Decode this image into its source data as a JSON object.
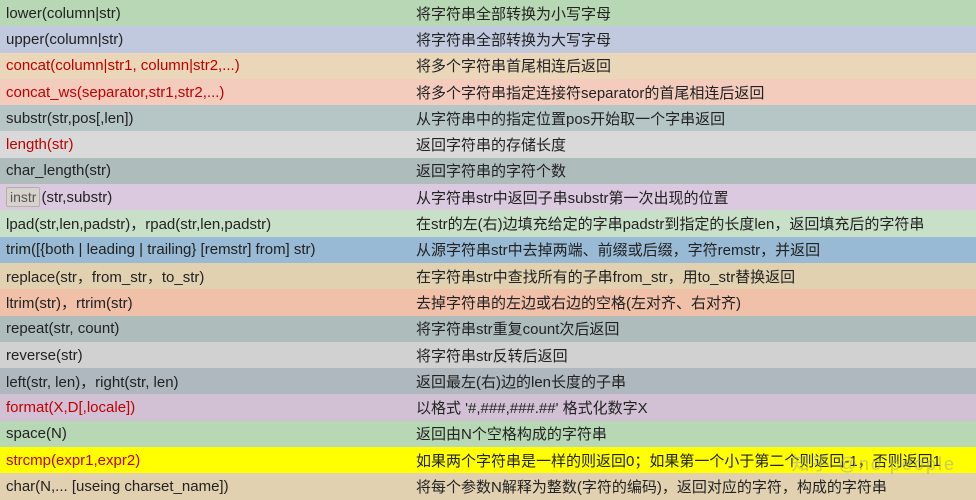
{
  "rows": [
    {
      "bg": "#b8d8b5",
      "func": "lower(column|str)",
      "red": false,
      "desc": "将字符串全部转换为小写字母"
    },
    {
      "bg": "#c0c9de",
      "func": "upper(column|str)",
      "red": false,
      "desc": "将字符串全部转换为大写字母"
    },
    {
      "bg": "#ead6b8",
      "func": "concat(column|str1, column|str2,...)",
      "red": true,
      "desc": "将多个字符串首尾相连后返回"
    },
    {
      "bg": "#f4ccbe",
      "func": "concat_ws(separator,str1,str2,...)",
      "red": true,
      "desc": "将多个字符串指定连接符separator的首尾相连后返回"
    },
    {
      "bg": "#b6c6c6",
      "func": "substr(str,pos[,len])",
      "red": false,
      "desc": "从字符串中的指定位置pos开始取一个字串返回"
    },
    {
      "bg": "#d9d9d9",
      "func": "length(str)",
      "red": true,
      "desc": "返回字符串的存储长度"
    },
    {
      "bg": "#aebdbb",
      "func": "char_length(str)",
      "red": false,
      "desc": "返回字符串的字符个数"
    },
    {
      "bg": "#dac9df",
      "func_html": true,
      "parts": [
        "instr",
        "(str,substr)"
      ],
      "desc": "从字符串str中返回子串substr第一次出现的位置"
    },
    {
      "bg": "#c9e0c8",
      "func": "lpad(str,len,padstr)，rpad(str,len,padstr)",
      "red": false,
      "desc": "在str的左(右)边填充给定的字串padstr到指定的长度len，返回填充后的字符串"
    },
    {
      "bg": "#98bad4",
      "func": "trim([{both | leading | trailing} [remstr] from] str)",
      "red": false,
      "desc": "从源字符串str中去掉两端、前缀或后缀，字符remstr，并返回"
    },
    {
      "bg": "#e2d1b1",
      "func": "replace(str，from_str，to_str)",
      "red": false,
      "desc": "在字符串str中查找所有的子串from_str，用to_str替换返回"
    },
    {
      "bg": "#f0c0a8",
      "func": "ltrim(str)，rtrim(str)",
      "red": false,
      "desc": "去掉字符串的左边或右边的空格(左对齐、右对齐)"
    },
    {
      "bg": "#aebdbb",
      "func": "repeat(str, count)",
      "red": false,
      "desc": "将字符串str重复count次后返回"
    },
    {
      "bg": "#d1d1d1",
      "func": "reverse(str)",
      "red": false,
      "desc": "将字符串str反转后返回"
    },
    {
      "bg": "#afb7bf",
      "func": "left(str, len)，right(str, len)",
      "red": false,
      "desc": "返回最左(右)边的len长度的子串"
    },
    {
      "bg": "#d2c1d5",
      "func": "format(X,D[,locale])",
      "red": true,
      "desc": "以格式 '#,###,###.##' 格式化数字X"
    },
    {
      "bg": "#b8d8b5",
      "func": "space(N)",
      "red": false,
      "desc": "返回由N个空格构成的字符串"
    },
    {
      "bg": "#ffff00",
      "func": "strcmp(expr1,expr2)",
      "red": true,
      "desc": "如果两个字符串是一样的则返回0；如果第一个小于第二个则返回-1，否则返回1"
    },
    {
      "bg": "#e2d1b1",
      "func": "char(N,... [useing  charset_name])",
      "red": false,
      "desc": "将每个参数N解释为整数(字符的编码)，返回对应的字符，构成的字符串"
    }
  ],
  "watermark": "知乎 @no people"
}
